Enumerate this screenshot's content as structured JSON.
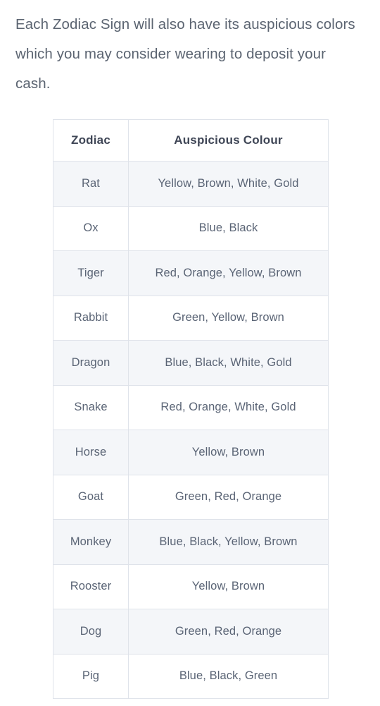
{
  "intro": {
    "paragraph": "Each Zodiac Sign will also have its auspicious colors which you may consider wearing to deposit your cash."
  },
  "table": {
    "headers": {
      "zodiac": "Zodiac",
      "colour": "Auspicious Colour"
    },
    "rows": [
      {
        "zodiac": "Rat",
        "colour": "Yellow, Brown, White, Gold"
      },
      {
        "zodiac": "Ox",
        "colour": "Blue, Black"
      },
      {
        "zodiac": "Tiger",
        "colour": "Red, Orange, Yellow, Brown"
      },
      {
        "zodiac": "Rabbit",
        "colour": "Green, Yellow, Brown"
      },
      {
        "zodiac": "Dragon",
        "colour": "Blue, Black, White, Gold"
      },
      {
        "zodiac": "Snake",
        "colour": "Red, Orange, White, Gold"
      },
      {
        "zodiac": "Horse",
        "colour": "Yellow, Brown"
      },
      {
        "zodiac": "Goat",
        "colour": "Green, Red, Orange"
      },
      {
        "zodiac": "Monkey",
        "colour": "Blue, Black, Yellow, Brown"
      },
      {
        "zodiac": "Rooster",
        "colour": "Yellow, Brown"
      },
      {
        "zodiac": "Dog",
        "colour": "Green, Red, Orange"
      },
      {
        "zodiac": "Pig",
        "colour": "Blue, Black, Green"
      }
    ]
  },
  "colors": {
    "body_text": "#5b6471",
    "header_text": "#3f4656",
    "cell_text": "#5a6475",
    "border": "#dfe3ea",
    "row_shaded": "#f4f6f9",
    "row_plain": "#ffffff",
    "background": "#ffffff"
  }
}
